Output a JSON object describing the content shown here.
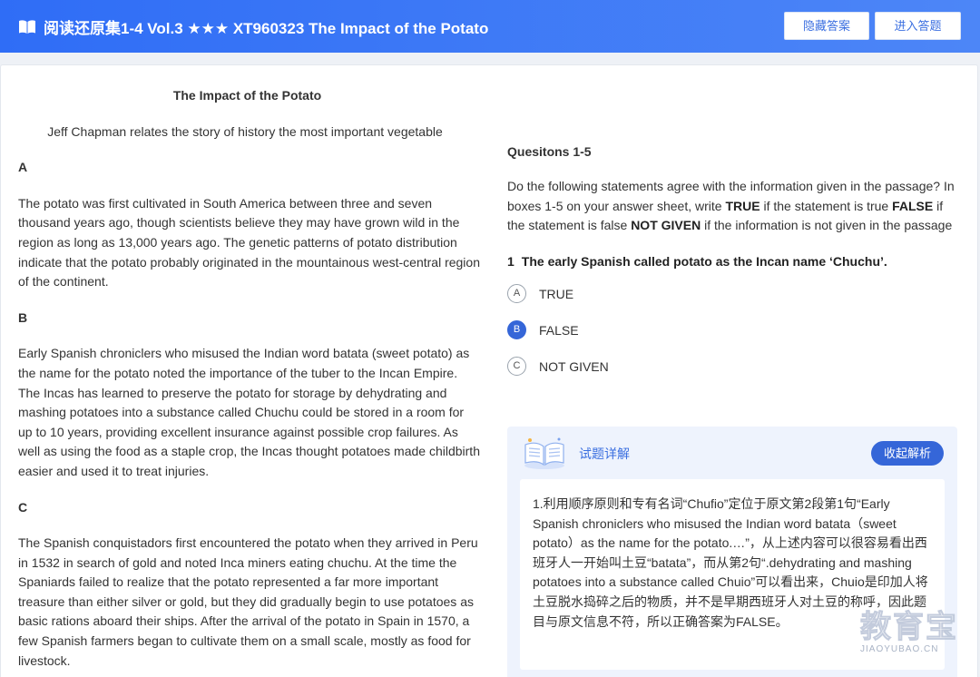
{
  "header": {
    "title": "阅读还原集1-4 Vol.3 ★★★ XT960323 The Impact of the Potato",
    "hide_answer_label": "隐藏答案",
    "enter_answer_label": "进入答题",
    "icon": "book-icon",
    "accent_color": "#2f6df6"
  },
  "passage": {
    "title": "The Impact of the Potato",
    "subtitle": "Jeff Chapman relates the story of history the most important vegetable",
    "sections": [
      {
        "letter": "A",
        "text": "The potato was first cultivated in South America between three and seven thousand years ago, though scientists believe they may have grown wild in the region as long as 13,000 years ago. The genetic patterns of potato distribution indicate that the potato probably originated in the mountainous west-central region of the continent."
      },
      {
        "letter": "B",
        "text": "Early Spanish chroniclers who misused the Indian word batata (sweet potato) as the name for the potato noted the importance of the tuber to the Incan Empire. The Incas has learned to preserve the potato for storage by dehydrating and mashing potatoes into a substance called Chuchu could be stored in a room for up to 10 years, providing excellent insurance against possible crop failures. As well as using the food as a staple crop, the Incas thought potatoes made childbirth easier and used it to treat injuries."
      },
      {
        "letter": "C",
        "text": "The Spanish conquistadors first encountered the potato when they arrived in Peru in 1532 in search of gold and noted Inca miners eating chuchu. At the time the Spaniards failed to realize that the potato represented a far more important treasure than either silver or gold, but they did gradually begin to use potatoes as basic rations aboard their ships. After the arrival of the potato in Spain in 1570, a few Spanish farmers began to cultivate them on a small scale, mostly as food for livestock."
      }
    ]
  },
  "questions": {
    "heading": "Quesitons 1-5",
    "instr_1": "Do the following statements agree with the information given in the passage? In boxes 1-5 on your answer sheet, write ",
    "instr_true": "TRUE",
    "instr_2": " if the statement is true ",
    "instr_false": "FALSE",
    "instr_3": " if the statement is false ",
    "instr_ng": "NOT GIVEN",
    "instr_4": " if the information is not given in the passage",
    "item_number": "1",
    "item_text": "The early Spanish called potato as the Incan name ‘Chuchu’.",
    "options": [
      {
        "letter": "A",
        "label": "TRUE"
      },
      {
        "letter": "B",
        "label": "FALSE"
      },
      {
        "letter": "C",
        "label": "NOT GIVEN"
      }
    ],
    "selected": "B"
  },
  "analysis": {
    "title": "试题详解",
    "collapse_label": "收起解析",
    "icon": "open-book-icon",
    "text": "1.利用顺序原则和专有名词“Chufio”定位于原文第2段第1句“Early Spanish chroniclers who misused the Indian word batata（sweet potato）as the name for the potato.…”，从上述内容可以很容易看出西班牙人一开始叫土豆“batata”，而从第2句“.dehydrating and mashing potatoes into a substance called Chuio”可以看出来，Chuio是印加人将土豆脱水捣碎之后的物质，并不是早期西班牙人对土豆的称呼，因此题目与原文信息不符，所以正确答案为FALSE。"
  },
  "watermark": {
    "cn": "教育宝",
    "en": "JIAOYUBAO.CN"
  }
}
